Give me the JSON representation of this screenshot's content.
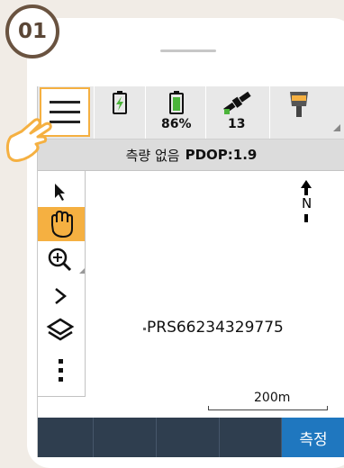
{
  "step": {
    "number": "01"
  },
  "toolbar": {
    "menu_icon": "hamburger-menu-icon",
    "battery1_icon": "battery-charging-icon",
    "battery2_icon": "battery-icon",
    "battery2_percent": "86%",
    "satellite_icon": "satellite-icon",
    "satellite_count": "13",
    "receiver_icon": "gnss-receiver-icon"
  },
  "status": {
    "survey_text": "측량 없음",
    "pdop_text": "PDOP:1.9"
  },
  "tools": [
    {
      "name": "select-arrow-icon"
    },
    {
      "name": "pan-hand-icon",
      "active": true
    },
    {
      "name": "zoom-in-icon"
    },
    {
      "name": "expand-chevron-icon"
    },
    {
      "name": "layers-icon"
    },
    {
      "name": "more-vertical-icon"
    }
  ],
  "map": {
    "north_label": "N",
    "point_label": "PRS66234329775",
    "scale_label": "200m"
  },
  "bottom_bar": {
    "measure_label": "측정"
  },
  "colors": {
    "accent": "#f5b041",
    "bottom_bar": "#2f3e4f",
    "measure_button": "#1f77bf",
    "badge_border": "#6a5340"
  }
}
